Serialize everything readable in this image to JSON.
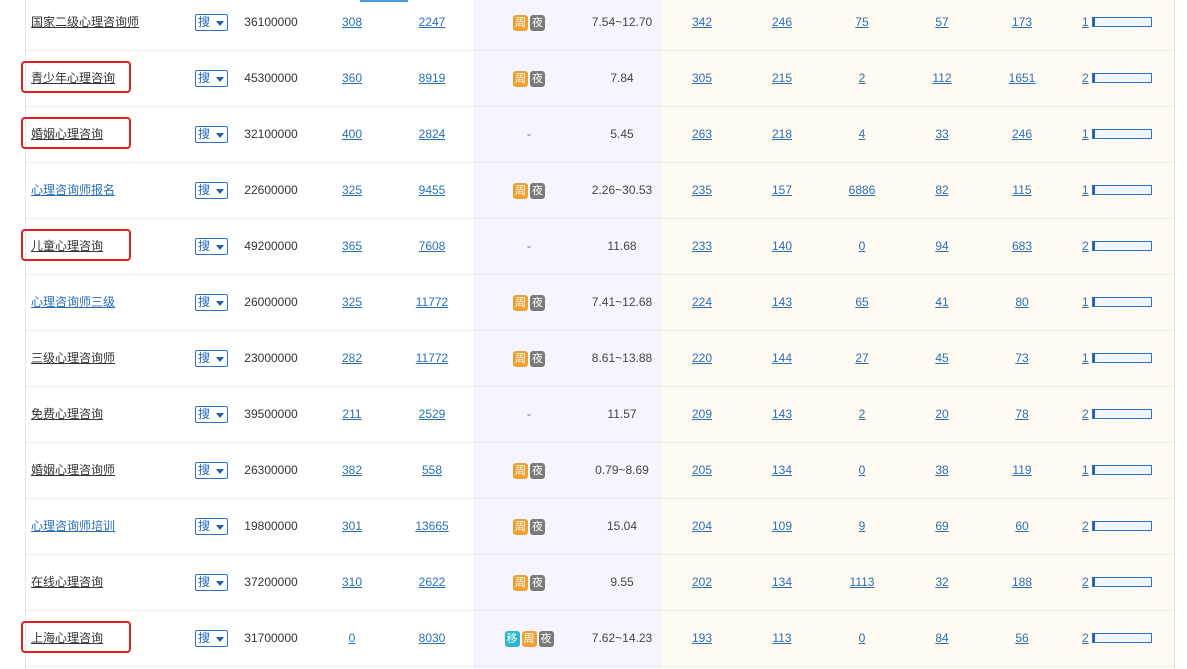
{
  "search_label": "搜",
  "tag_labels": {
    "zhou": "周",
    "ye": "夜",
    "yi": "移"
  },
  "colors": {
    "link": "#2a6fb5",
    "highlight": "#e02020",
    "tag_zhou": "#f0a033",
    "tag_ye": "#7a7a7a",
    "tag_yi": "#2bb9c8"
  },
  "rows": [
    {
      "keyword": "国家二级心理咨询师",
      "blue": false,
      "highlighted": false,
      "volume": "36100000",
      "c1": "308",
      "c2": "2247",
      "tags": [
        "zhou",
        "ye"
      ],
      "price": "7.54~12.70",
      "c3": "342",
      "c4": "246",
      "c5": "75",
      "c6": "57",
      "c7": "173",
      "rank": "1",
      "bar_fraction": 0.04
    },
    {
      "keyword": "青少年心理咨询",
      "blue": false,
      "highlighted": true,
      "volume": "45300000",
      "c1": "360",
      "c2": "8919",
      "tags": [
        "zhou",
        "ye"
      ],
      "price": "7.84",
      "c3": "305",
      "c4": "215",
      "c5": "2",
      "c6": "112",
      "c7": "1651",
      "rank": "2",
      "bar_fraction": 0.04
    },
    {
      "keyword": "婚姻心理咨询",
      "blue": false,
      "highlighted": true,
      "volume": "32100000",
      "c1": "400",
      "c2": "2824",
      "tags": [],
      "price": "5.45",
      "c3": "263",
      "c4": "218",
      "c5": "4",
      "c6": "33",
      "c7": "246",
      "rank": "1",
      "bar_fraction": 0.04
    },
    {
      "keyword": "心理咨询师报名",
      "blue": true,
      "highlighted": false,
      "volume": "22600000",
      "c1": "325",
      "c2": "9455",
      "tags": [
        "zhou",
        "ye"
      ],
      "price": "2.26~30.53",
      "c3": "235",
      "c4": "157",
      "c5": "6886",
      "c6": "82",
      "c7": "115",
      "rank": "1",
      "bar_fraction": 0.04
    },
    {
      "keyword": "儿童心理咨询",
      "blue": false,
      "highlighted": true,
      "volume": "49200000",
      "c1": "365",
      "c2": "7608",
      "tags": [],
      "price": "11.68",
      "c3": "233",
      "c4": "140",
      "c5": "0",
      "c6": "94",
      "c7": "683",
      "rank": "2",
      "bar_fraction": 0.04
    },
    {
      "keyword": "心理咨询师三级",
      "blue": true,
      "highlighted": false,
      "volume": "26000000",
      "c1": "325",
      "c2": "11772",
      "tags": [
        "zhou",
        "ye"
      ],
      "price": "7.41~12.68",
      "c3": "224",
      "c4": "143",
      "c5": "65",
      "c6": "41",
      "c7": "80",
      "rank": "1",
      "bar_fraction": 0.04
    },
    {
      "keyword": "三级心理咨询师",
      "blue": false,
      "highlighted": false,
      "volume": "23000000",
      "c1": "282",
      "c2": "11772",
      "tags": [
        "zhou",
        "ye"
      ],
      "price": "8.61~13.88",
      "c3": "220",
      "c4": "144",
      "c5": "27",
      "c6": "45",
      "c7": "73",
      "rank": "1",
      "bar_fraction": 0.04
    },
    {
      "keyword": "免费心理咨询",
      "blue": false,
      "highlighted": false,
      "volume": "39500000",
      "c1": "211",
      "c2": "2529",
      "tags": [],
      "price": "11.57",
      "c3": "209",
      "c4": "143",
      "c5": "2",
      "c6": "20",
      "c7": "78",
      "rank": "2",
      "bar_fraction": 0.04
    },
    {
      "keyword": "婚姻心理咨询师",
      "blue": false,
      "highlighted": false,
      "volume": "26300000",
      "c1": "382",
      "c2": "558",
      "tags": [
        "zhou",
        "ye"
      ],
      "price": "0.79~8.69",
      "c3": "205",
      "c4": "134",
      "c5": "0",
      "c6": "38",
      "c7": "119",
      "rank": "1",
      "bar_fraction": 0.04
    },
    {
      "keyword": "心理咨询师培训",
      "blue": true,
      "highlighted": false,
      "volume": "19800000",
      "c1": "301",
      "c2": "13665",
      "tags": [
        "zhou",
        "ye"
      ],
      "price": "15.04",
      "c3": "204",
      "c4": "109",
      "c5": "9",
      "c6": "69",
      "c7": "60",
      "rank": "2",
      "bar_fraction": 0.04
    },
    {
      "keyword": "在线心理咨询",
      "blue": false,
      "highlighted": false,
      "volume": "37200000",
      "c1": "310",
      "c2": "2622",
      "tags": [
        "zhou",
        "ye"
      ],
      "price": "9.55",
      "c3": "202",
      "c4": "134",
      "c5": "1113",
      "c6": "32",
      "c7": "188",
      "rank": "2",
      "bar_fraction": 0.04
    },
    {
      "keyword": "上海心理咨询",
      "blue": false,
      "highlighted": true,
      "volume": "31700000",
      "c1": "0",
      "c2": "8030",
      "tags": [
        "yi",
        "zhou",
        "ye"
      ],
      "price": "7.62~14.23",
      "c3": "193",
      "c4": "113",
      "c5": "0",
      "c6": "84",
      "c7": "56",
      "rank": "2",
      "bar_fraction": 0.04
    }
  ]
}
